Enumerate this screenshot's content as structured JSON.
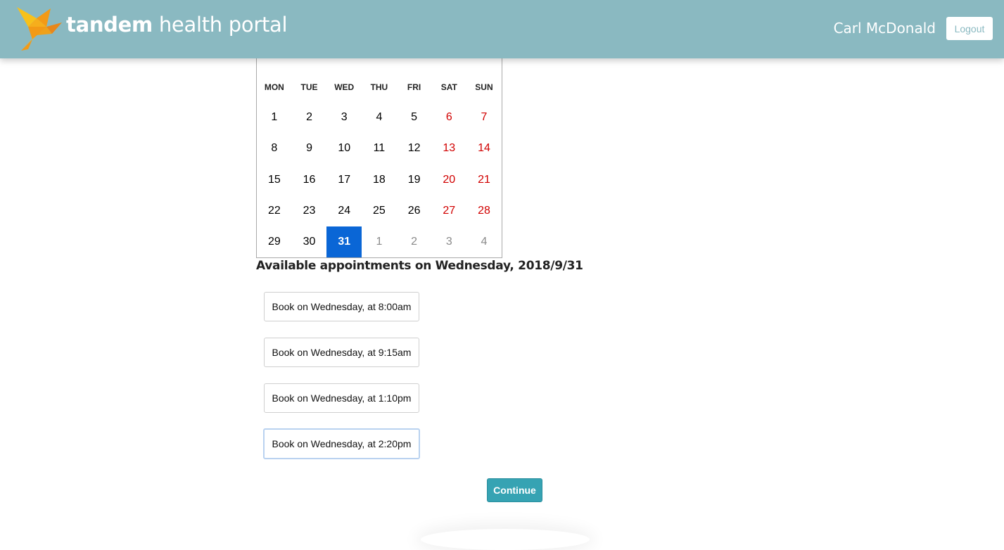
{
  "header": {
    "brand_bold": "tandem",
    "brand_rest": " health portal",
    "user_name": "Carl McDonald",
    "logout_label": "Logout",
    "logo_icon": "origami-bird-icon",
    "colors": {
      "bar": "#8ab9c1",
      "logo_orange": "#f39a16",
      "logo_yellow": "#f8c11a"
    }
  },
  "calendar": {
    "weekdays": [
      "MON",
      "TUE",
      "WED",
      "THU",
      "FRI",
      "SAT",
      "SUN"
    ],
    "days": [
      {
        "label": "1",
        "kind": "normal"
      },
      {
        "label": "2",
        "kind": "normal"
      },
      {
        "label": "3",
        "kind": "normal"
      },
      {
        "label": "4",
        "kind": "normal"
      },
      {
        "label": "5",
        "kind": "normal"
      },
      {
        "label": "6",
        "kind": "weekend"
      },
      {
        "label": "7",
        "kind": "weekend"
      },
      {
        "label": "8",
        "kind": "normal"
      },
      {
        "label": "9",
        "kind": "normal"
      },
      {
        "label": "10",
        "kind": "normal"
      },
      {
        "label": "11",
        "kind": "normal"
      },
      {
        "label": "12",
        "kind": "normal"
      },
      {
        "label": "13",
        "kind": "weekend"
      },
      {
        "label": "14",
        "kind": "weekend"
      },
      {
        "label": "15",
        "kind": "normal"
      },
      {
        "label": "16",
        "kind": "normal"
      },
      {
        "label": "17",
        "kind": "normal"
      },
      {
        "label": "18",
        "kind": "normal"
      },
      {
        "label": "19",
        "kind": "normal"
      },
      {
        "label": "20",
        "kind": "weekend"
      },
      {
        "label": "21",
        "kind": "weekend"
      },
      {
        "label": "22",
        "kind": "normal"
      },
      {
        "label": "23",
        "kind": "normal"
      },
      {
        "label": "24",
        "kind": "normal"
      },
      {
        "label": "25",
        "kind": "normal"
      },
      {
        "label": "26",
        "kind": "normal"
      },
      {
        "label": "27",
        "kind": "weekend"
      },
      {
        "label": "28",
        "kind": "weekend"
      },
      {
        "label": "29",
        "kind": "normal"
      },
      {
        "label": "30",
        "kind": "normal"
      },
      {
        "label": "31",
        "kind": "selected"
      },
      {
        "label": "1",
        "kind": "other"
      },
      {
        "label": "2",
        "kind": "other"
      },
      {
        "label": "3",
        "kind": "other"
      },
      {
        "label": "4",
        "kind": "other"
      }
    ],
    "colors": {
      "weekend": "#d10000",
      "selected_bg": "#0a66d6",
      "other_month": "#8a8a8a"
    }
  },
  "appointments": {
    "title": "Available appointments on Wednesday, 2018/9/31",
    "slots": [
      {
        "label": "Book on Wednesday, at 8:00am",
        "focused": false
      },
      {
        "label": "Book on Wednesday, at 9:15am",
        "focused": false
      },
      {
        "label": "Book on Wednesday, at 1:10pm",
        "focused": false
      },
      {
        "label": "Book on Wednesday, at 2:20pm",
        "focused": true
      }
    ]
  },
  "actions": {
    "continue_label": "Continue",
    "continue_color": "#36a3b3"
  }
}
